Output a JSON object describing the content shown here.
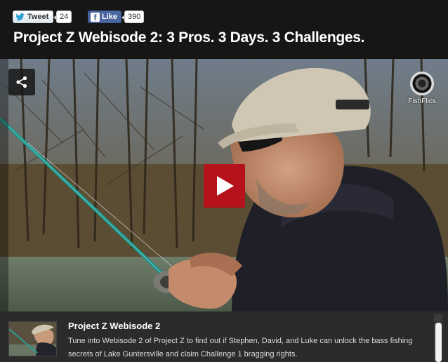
{
  "social": {
    "tweet_label": "Tweet",
    "tweet_count": "24",
    "like_label": "Like",
    "like_count": "390"
  },
  "page_title": "Project Z Webisode 2: 3 Pros. 3 Days. 3 Challenges.",
  "player": {
    "brand_label": "FishFlics",
    "share_icon": "share-icon",
    "play_icon": "play-icon",
    "colors": {
      "play_button": "#b5121b"
    }
  },
  "episode": {
    "title": "Project Z Webisode 2",
    "description": "Tune into Webisode 2 of Project Z to find out if Stephen, David, and Luke can unlock the bass fishing secrets of Lake Guntersville and claim Challenge 1 bragging rights."
  }
}
